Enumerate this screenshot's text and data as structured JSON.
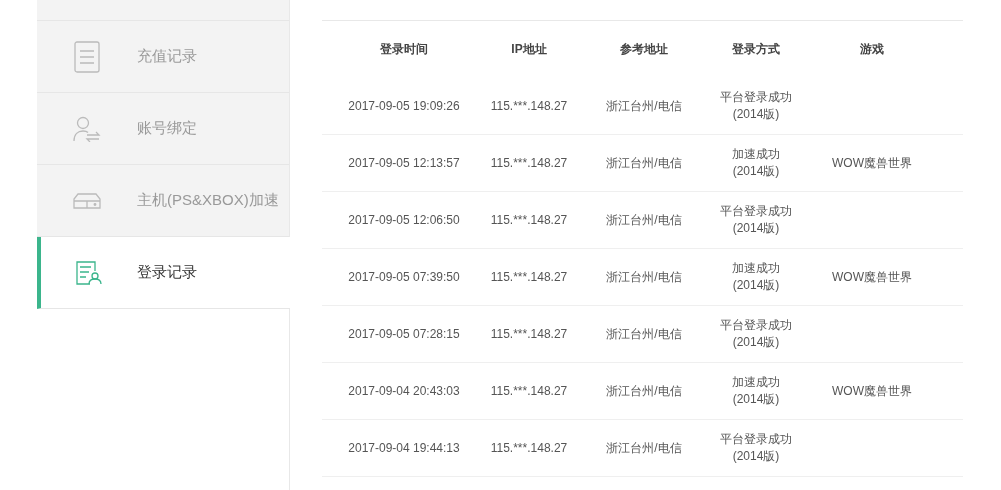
{
  "sidebar": {
    "items": [
      {
        "label": "充值记录",
        "selected": false
      },
      {
        "label": "账号绑定",
        "selected": false
      },
      {
        "label": "主机(PS&XBOX)加速",
        "selected": false
      },
      {
        "label": "登录记录",
        "selected": true
      }
    ]
  },
  "table": {
    "columns": [
      "登录时间",
      "IP地址",
      "参考地址",
      "登录方式",
      "游戏"
    ],
    "rows": [
      [
        "2017-09-05 19:09:26",
        "115.***.148.27",
        "浙江台州/电信",
        "平台登录成功\n(2014版)",
        ""
      ],
      [
        "2017-09-05 12:13:57",
        "115.***.148.27",
        "浙江台州/电信",
        "加速成功\n(2014版)",
        "WOW魔兽世界"
      ],
      [
        "2017-09-05 12:06:50",
        "115.***.148.27",
        "浙江台州/电信",
        "平台登录成功\n(2014版)",
        ""
      ],
      [
        "2017-09-05 07:39:50",
        "115.***.148.27",
        "浙江台州/电信",
        "加速成功\n(2014版)",
        "WOW魔兽世界"
      ],
      [
        "2017-09-05 07:28:15",
        "115.***.148.27",
        "浙江台州/电信",
        "平台登录成功\n(2014版)",
        ""
      ],
      [
        "2017-09-04 20:43:03",
        "115.***.148.27",
        "浙江台州/电信",
        "加速成功\n(2014版)",
        "WOW魔兽世界"
      ],
      [
        "2017-09-04 19:44:13",
        "115.***.148.27",
        "浙江台州/电信",
        "平台登录成功\n(2014版)",
        ""
      ]
    ]
  }
}
